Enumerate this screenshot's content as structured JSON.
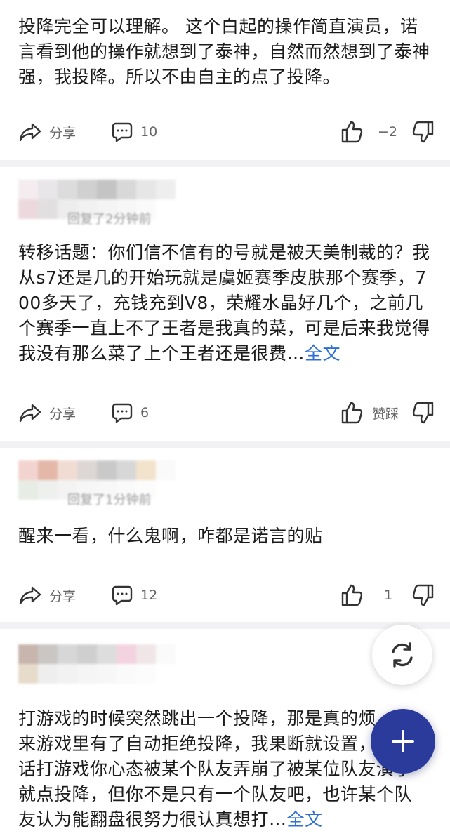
{
  "comments": [
    {
      "text": "投降完全可以理解。 这个白起的操作简直演员，诺言看到他的操作就想到了泰神，自然而然想到了泰神强，我投降。所以不由自主的点了投降。",
      "share_label": "分享",
      "reply_count": "10",
      "vote_score": "−2"
    },
    {
      "time_text": "回复了2分钟前",
      "text": "转移话题：你们信不信有的号就是被天美制裁的？我从s7还是几的开始玩就是虞姬赛季皮肤那个赛季，700多天了，充钱充到V8，荣耀水晶好几个，之前几个赛季一直上不了王者是我真的菜，可是后来我觉得我没有那么菜了上个王者还是很费…",
      "more_label": "全文",
      "share_label": "分享",
      "reply_count": "6",
      "vote_score": "赞踩"
    },
    {
      "time_text": "回复了1分钟前",
      "text": "醒来一看，什么鬼啊，咋都是诺言的贴",
      "share_label": "分享",
      "reply_count": "12",
      "vote_score": "1"
    },
    {
      "text": "打游戏的时候突然跳出一个投降，那是真的烦，后来游戏里有了自动拒绝投降，我果断就设置，说实话打游戏你心态被某个队友弄崩了被某位队友演了就点投降，但你不是只有一个队友吧，也许某个队友认为能翻盘很努力很认真想打…",
      "more_label": "全文"
    }
  ],
  "icons": {
    "share": "share-arrow-icon",
    "comment": "comment-bubble-icon",
    "like": "thumbs-up-icon",
    "dislike": "thumbs-down-icon",
    "refresh": "refresh-icon",
    "add": "plus-icon"
  },
  "colors": {
    "link": "#2e6fd6",
    "fab": "#2a3b9c",
    "divider": "#f2f2f4"
  }
}
